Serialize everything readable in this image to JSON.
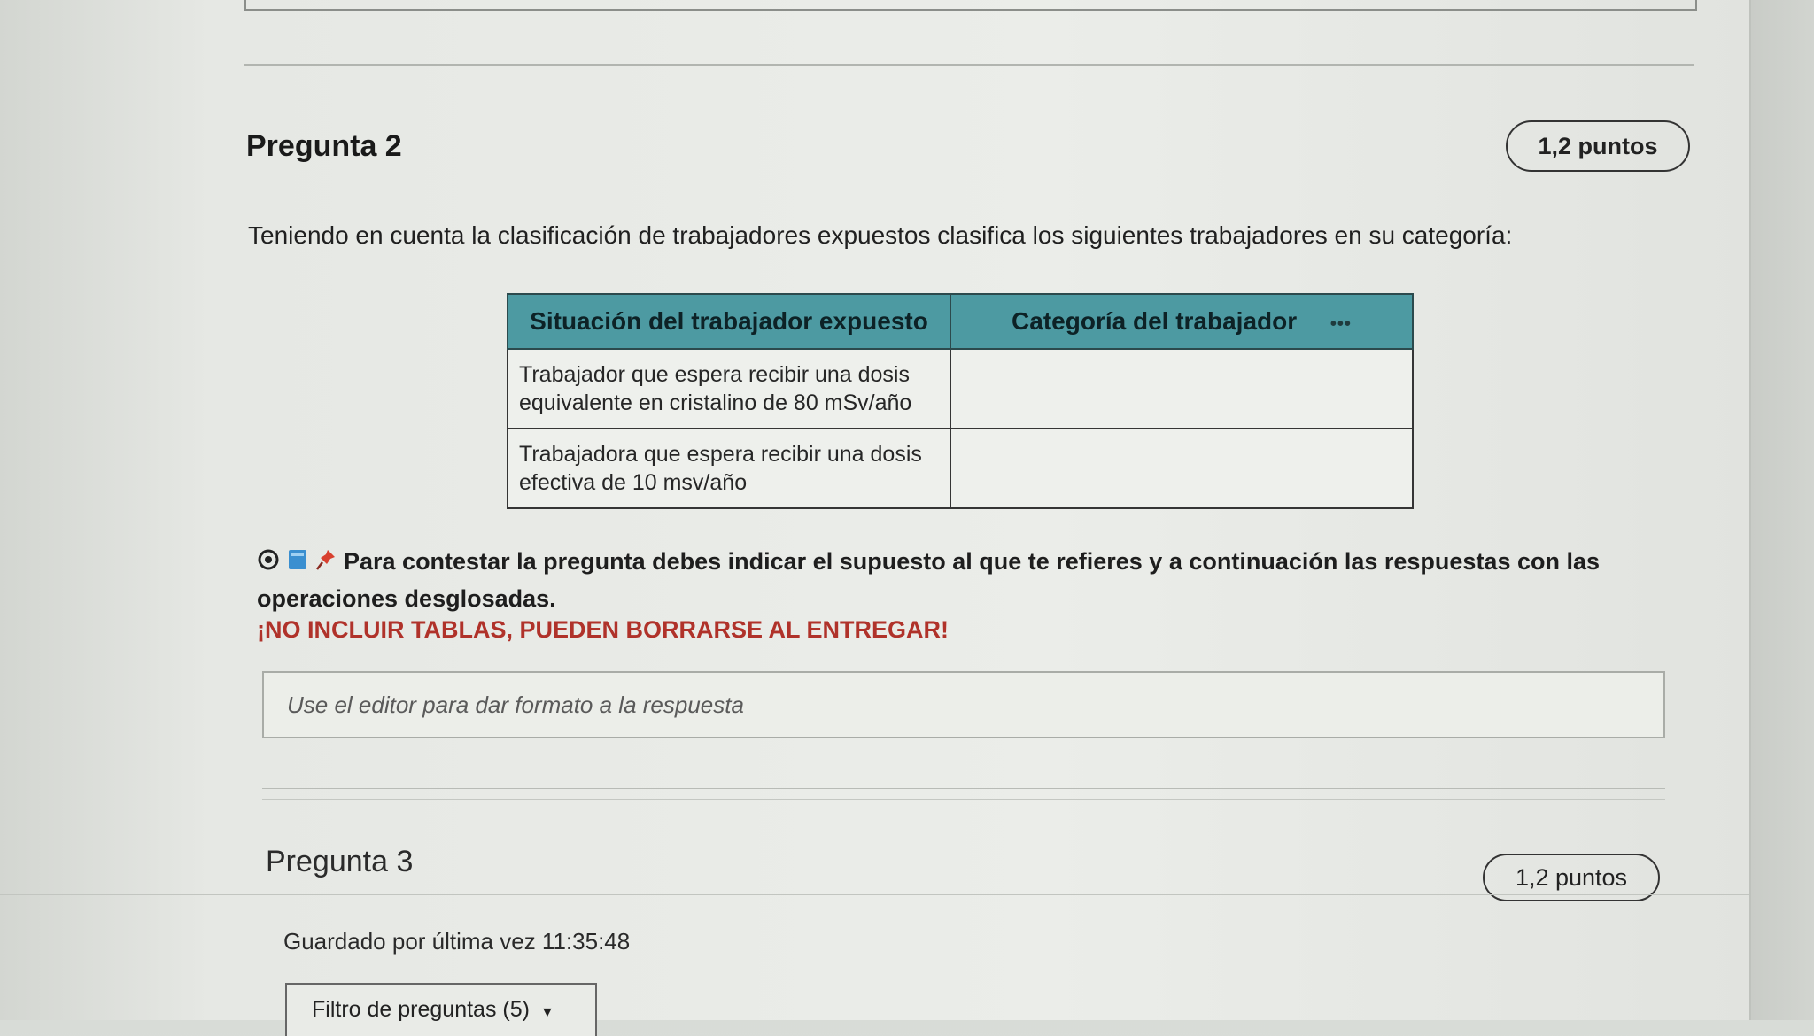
{
  "question2": {
    "title": "Pregunta 2",
    "points": "1,2 puntos",
    "prompt": "Teniendo en cuenta la clasificación de trabajadores expuestos clasifica los siguientes trabajadores en su categoría:",
    "table": {
      "headers": [
        "Situación del trabajador expuesto",
        "Categoría del trabajador"
      ],
      "more_glyph": "•••",
      "rows": [
        {
          "situation_line1": "Trabajador que espera recibir una dosis",
          "situation_line2": "equivalente en cristalino de 80 mSv/año",
          "category": ""
        },
        {
          "situation_line1": "Trabajadora que espera recibir una dosis",
          "situation_line2": "efectiva de 10 msv/año",
          "category": ""
        }
      ]
    },
    "instruction": "Para contestar la pregunta debes indicar el supuesto al que te refieres y a continuación las respuestas con las operaciones desglosadas.",
    "warning": "¡NO INCLUIR TABLAS, PUEDEN BORRARSE AL ENTREGAR!",
    "editor_placeholder": "Use el editor para dar formato a la respuesta",
    "icons": [
      "eye-icon",
      "book-icon",
      "pin-icon"
    ]
  },
  "question3": {
    "title": "Pregunta 3",
    "points": "1,2 puntos"
  },
  "footer": {
    "saved_text": "Guardado por última vez 11:35:48",
    "filter_label": "Filtro de preguntas (5)",
    "filter_caret": "▼"
  },
  "colors": {
    "table_header": "#4d9aa2",
    "warning": "#b0322a",
    "pin": "#d8402f",
    "book": "#3a8fd0"
  }
}
